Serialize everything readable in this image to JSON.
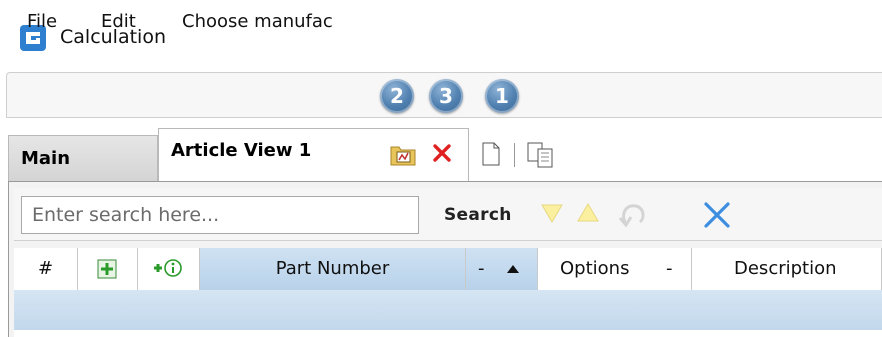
{
  "window": {
    "title": "Calculation"
  },
  "menu": {
    "items": [
      "File",
      "Edit",
      "Choose manufac"
    ]
  },
  "badges": [
    "2",
    "3",
    "1"
  ],
  "tabs": {
    "main": "Main",
    "active": "Article View 1"
  },
  "search": {
    "placeholder": "Enter search here...",
    "button": "Search"
  },
  "grid": {
    "columns": [
      "#",
      "Part Number",
      "-",
      "Options",
      "-",
      "Description"
    ]
  },
  "colors": {
    "accent_blue": "#3d8ee0",
    "badge_blue": "#4f7faf",
    "close_red": "#e02020",
    "sorted_column": "#c3d8ec"
  },
  "icons": [
    "app-logo-icon",
    "overview-icon",
    "close-tab-icon",
    "new-page-icon",
    "copy-page-icon",
    "filter-down-icon",
    "filter-up-icon",
    "undo-icon",
    "clear-search-icon",
    "add-row-icon",
    "add-info-icon",
    "sort-ascending-icon"
  ]
}
